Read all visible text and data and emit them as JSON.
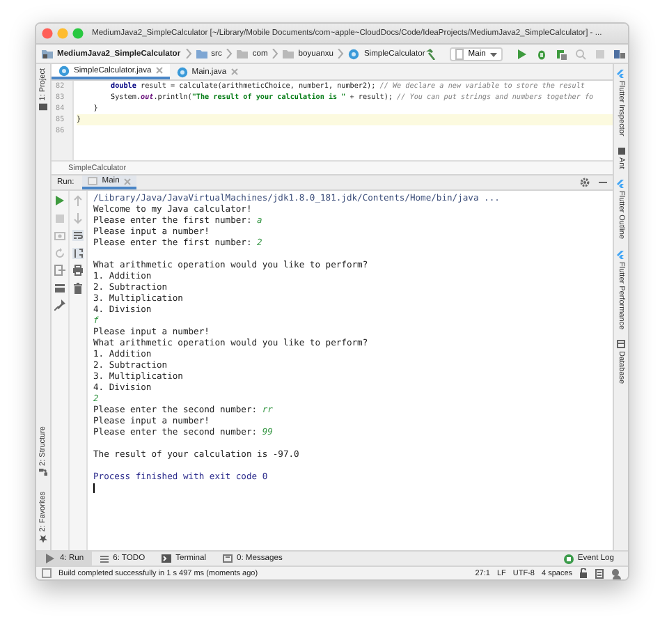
{
  "window": {
    "title": "MediumJava2_SimpleCalculator [~/Library/Mobile Documents/com~apple~CloudDocs/Code/IdeaProjects/MediumJava2_SimpleCalculator] - ..."
  },
  "navbar": {
    "breadcrumbs": [
      {
        "label": "MediumJava2_SimpleCalculator",
        "kind": "project"
      },
      {
        "label": "src",
        "kind": "folder"
      },
      {
        "label": "com",
        "kind": "package"
      },
      {
        "label": "boyuanxu",
        "kind": "package"
      },
      {
        "label": "SimpleCalculator",
        "kind": "class"
      }
    ],
    "run_config": "Main"
  },
  "left_strip": {
    "top": [
      "1: Project"
    ],
    "bottom": [
      "2: Structure",
      "2: Favorites"
    ]
  },
  "right_strip": [
    "Flutter Inspector",
    "Ant",
    "Flutter Outline",
    "Flutter Performance",
    "Database"
  ],
  "editor": {
    "tabs": [
      {
        "label": "SimpleCalculator.java",
        "kind": "class",
        "selected": true
      },
      {
        "label": "Main.java",
        "kind": "class",
        "selected": false
      }
    ],
    "lines": [
      {
        "number": "82",
        "current": false,
        "parts": [
          {
            "t": "        double",
            "kind": "keyword"
          },
          {
            "t": " result = calculate(arithmeticChoice, number1, number2); ",
            "kind": "plain"
          },
          {
            "t": "// We declare a new variable to store the result",
            "kind": "comment"
          }
        ]
      },
      {
        "number": "83",
        "current": false,
        "parts": [
          {
            "t": "        System.",
            "kind": "plain"
          },
          {
            "t": "out",
            "kind": "field"
          },
          {
            "t": ".println(",
            "kind": "plain"
          },
          {
            "t": "\"The result of your calculation is \"",
            "kind": "string"
          },
          {
            "t": " + result); ",
            "kind": "plain"
          },
          {
            "t": "// You can put strings and numbers together fo",
            "kind": "comment"
          }
        ]
      },
      {
        "number": "84",
        "current": false,
        "parts": [
          {
            "t": "    }",
            "kind": "plain"
          }
        ]
      },
      {
        "number": "85",
        "current": true,
        "parts": [
          {
            "t": "}",
            "kind": "plain"
          }
        ]
      },
      {
        "number": "86",
        "current": false
      }
    ],
    "breadcrumb": "SimpleCalculator"
  },
  "run_panel": {
    "label": "Run:",
    "tabs": [
      {
        "label": "Main",
        "selected": true
      }
    ],
    "console": [
      {
        "kind": "command",
        "text": "/Library/Java/JavaVirtualMachines/jdk1.8.0_181.jdk/Contents/Home/bin/java ..."
      },
      {
        "kind": "output",
        "text": "Welcome to my Java calculator!"
      },
      {
        "kind": "output",
        "text": "Please enter the first number: ",
        "input": "a"
      },
      {
        "kind": "output",
        "text": "Please input a number!"
      },
      {
        "kind": "output",
        "text": "Please enter the first number: ",
        "input": "2"
      },
      {
        "kind": "blank"
      },
      {
        "kind": "output",
        "text": "What arithmetic operation would you like to perform?"
      },
      {
        "kind": "output",
        "text": "1. Addition"
      },
      {
        "kind": "output",
        "text": "2. Subtraction"
      },
      {
        "kind": "output",
        "text": "3. Multiplication"
      },
      {
        "kind": "output",
        "text": "4. Division"
      },
      {
        "kind": "output",
        "input": "f"
      },
      {
        "kind": "output",
        "text": "Please input a number!"
      },
      {
        "kind": "output",
        "text": "What arithmetic operation would you like to perform?"
      },
      {
        "kind": "output",
        "text": "1. Addition"
      },
      {
        "kind": "output",
        "text": "2. Subtraction"
      },
      {
        "kind": "output",
        "text": "3. Multiplication"
      },
      {
        "kind": "output",
        "text": "4. Division"
      },
      {
        "kind": "output",
        "input": "2"
      },
      {
        "kind": "output",
        "text": "Please enter the second number: ",
        "input": "rr"
      },
      {
        "kind": "output",
        "text": "Please input a number!"
      },
      {
        "kind": "output",
        "text": "Please enter the second number: ",
        "input": "99"
      },
      {
        "kind": "blank"
      },
      {
        "kind": "output",
        "text": "The result of your calculation is -97.0"
      },
      {
        "kind": "blank"
      },
      {
        "kind": "exit",
        "text": "Process finished with exit code 0"
      },
      {
        "kind": "cursor"
      }
    ]
  },
  "bottom_tabs": [
    {
      "label": "4: Run",
      "kind": "run",
      "selected": true
    },
    {
      "label": "6: TODO",
      "kind": "todo",
      "selected": false
    },
    {
      "label": "Terminal",
      "kind": "terminal",
      "selected": false
    },
    {
      "label": "0: Messages",
      "kind": "messages",
      "selected": false
    }
  ],
  "event_log": "Event Log",
  "status_bar": {
    "message": "Build completed successfully in 1 s 497 ms (moments ago)",
    "items": [
      "27:1",
      "LF",
      "UTF-8",
      "4 spaces"
    ]
  }
}
